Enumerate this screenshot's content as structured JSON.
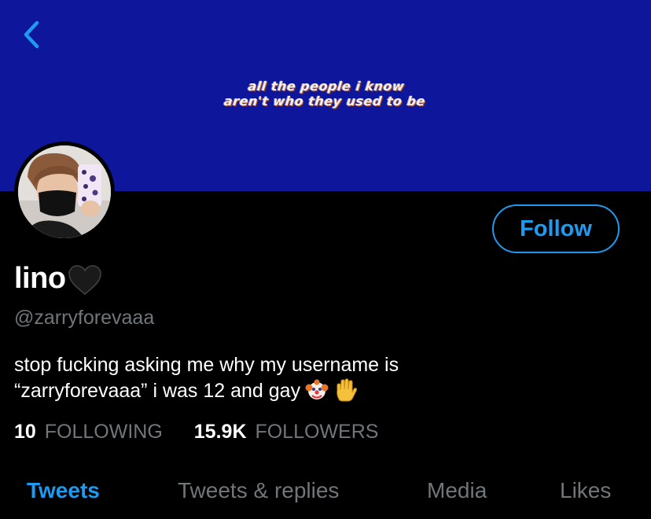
{
  "banner": {
    "caption_line1": "all the people i know",
    "caption_line2": "aren't who they used to be",
    "color": "#0e169b"
  },
  "header": {
    "back_icon": "chevron-left-icon"
  },
  "profile": {
    "display_name": "lino",
    "name_emoji": "black-heart-icon",
    "handle": "@zarryforevaaa",
    "bio_line1": "stop fucking asking me why my username is",
    "bio_line2": "“zarryforevaaa” i was 12 and gay",
    "bio_emojis": [
      "clown-face-icon",
      "raised-hand-icon"
    ],
    "follow_label": "Follow"
  },
  "stats": {
    "following_count": "10",
    "following_label": "FOLLOWING",
    "followers_count": "15.9K",
    "followers_label": "FOLLOWERS"
  },
  "tabs": [
    {
      "label": "Tweets",
      "active": true
    },
    {
      "label": "Tweets & replies",
      "active": false
    },
    {
      "label": "Media",
      "active": false
    },
    {
      "label": "Likes",
      "active": false
    }
  ],
  "colors": {
    "accent": "#1d9bf0",
    "muted": "#71767b",
    "background": "#000000"
  }
}
